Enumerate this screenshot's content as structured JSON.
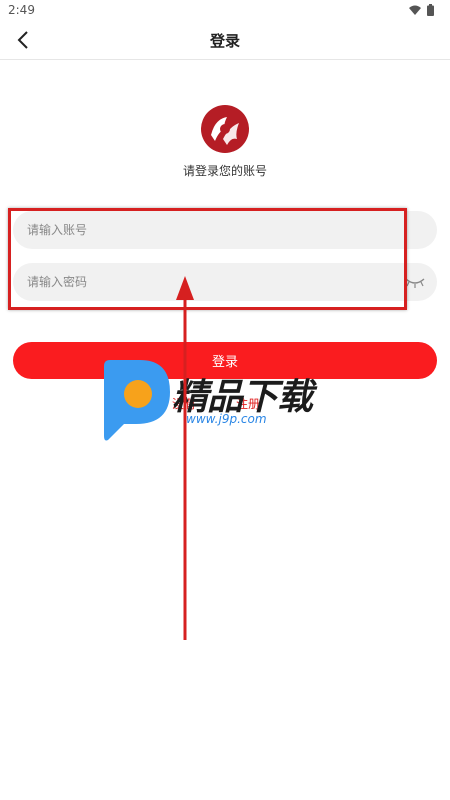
{
  "status_bar": {
    "time": "2:49",
    "icons": [
      "wifi-icon",
      "battery-icon"
    ]
  },
  "nav": {
    "title": "登录",
    "back_icon": "chevron-left-icon"
  },
  "login_form": {
    "prompt": "请登录您的账号",
    "account_placeholder": "请输入账号",
    "password_placeholder": "请输入密码",
    "password_toggle_icon": "eye-closed-icon",
    "submit_label": "登录",
    "register_text_left": "没有",
    "register_text_right": "注册"
  },
  "watermark": {
    "title": "精品下载",
    "url": "www.j9p.com"
  },
  "colors": {
    "accent": "#fa1c1f",
    "highlight": "#d62020",
    "watermark_blue": "#2a86e5",
    "watermark_orange": "#f7a21b"
  }
}
